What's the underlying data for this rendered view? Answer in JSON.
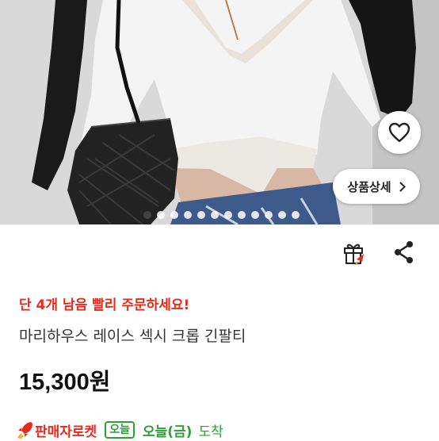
{
  "product_image": {
    "alt_icon": "photo",
    "detail_button_label": "상품상세",
    "slide_count": 12,
    "active_slide": 1
  },
  "actions": {
    "gift_icon": "gift-icon",
    "share_icon": "share-icon",
    "wishlist_icon": "heart-icon"
  },
  "stock_message": "단 4개 남음 빨리 주문하세요!",
  "product_title": "마리하우스 레이스 섹시 크롭 긴팔티",
  "price": "15,300원",
  "delivery": {
    "badge_label": "판매자로켓",
    "today_label": "오늘",
    "arrival_date": "오늘(금)",
    "arrival_word": "도착"
  },
  "colors": {
    "stock_red": "#e8291c",
    "delivery_green": "#2e9e3a"
  }
}
